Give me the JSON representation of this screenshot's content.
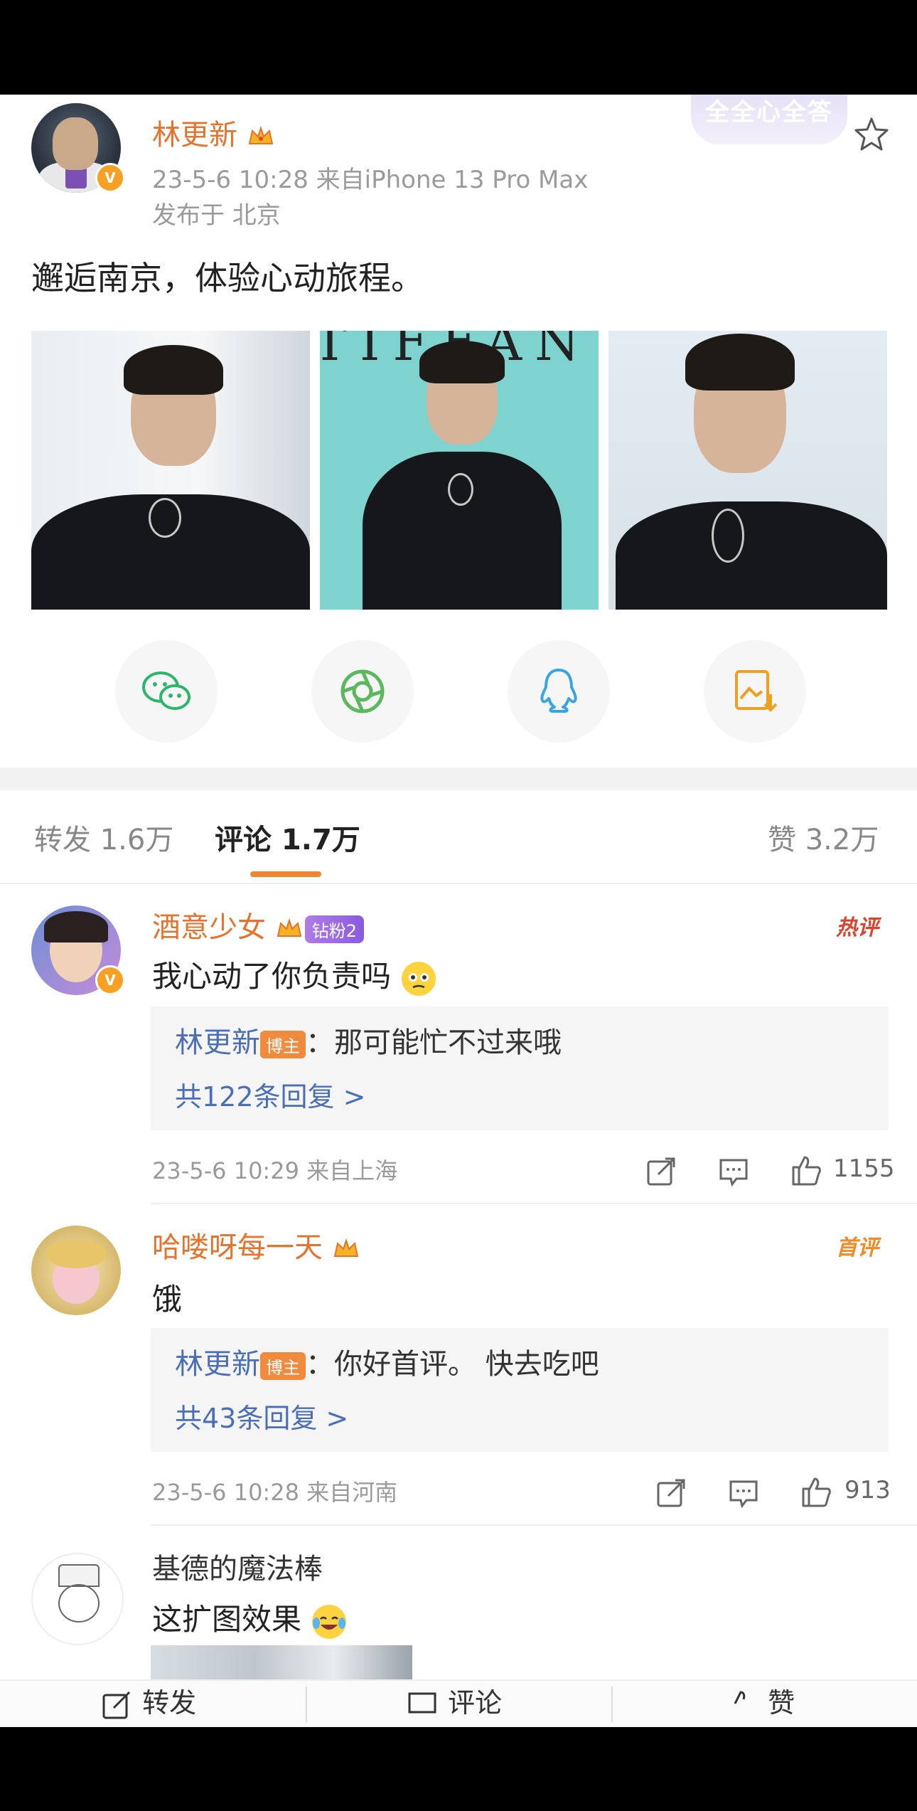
{
  "post": {
    "author": "林更新",
    "time_source": "23-5-6 10:28  来自iPhone 13 Pro Max",
    "location": "发布于 北京",
    "text": "邂逅南京，体验心动旅程。",
    "photo_sign": "TIFFANY"
  },
  "sticker": {
    "text": "全全心全答"
  },
  "share": {
    "icons": [
      "wechat-icon",
      "moments-icon",
      "qq-icon",
      "save-image-icon"
    ]
  },
  "tabs": {
    "repost": "转发 1.6万",
    "comment": "评论 1.7万",
    "like": "赞 3.2万"
  },
  "comments": [
    {
      "name": "酒意少女",
      "fan_badge": "钻粉2",
      "tag": "热评",
      "text": "我心动了你负责吗",
      "reply_name": "林更新",
      "owner_badge": "博主",
      "reply_text": "：那可能忙不过来哦",
      "reply_more": "共122条回复 >",
      "meta": "23-5-6 10:29  来自上海",
      "likes": "1155"
    },
    {
      "name": "哈喽呀每一天",
      "tag": "首评",
      "text": "饿",
      "reply_name": "林更新",
      "owner_badge": "博主",
      "reply_text": "：你好首评。 快去吃吧",
      "reply_more": "共43条回复 >",
      "meta": "23-5-6 10:28  来自河南",
      "likes": "913"
    },
    {
      "name": "基德的魔法棒",
      "text": "这扩图效果"
    }
  ],
  "bottom_bar": {
    "repost": "转发",
    "comment": "评论",
    "like": "赞"
  },
  "colors": {
    "accent": "#e8722a",
    "link": "#4a6fb8",
    "wechat": "#2bb66b",
    "moments": "#5cb85c",
    "qq": "#3aa3e3",
    "save": "#f0a021"
  }
}
